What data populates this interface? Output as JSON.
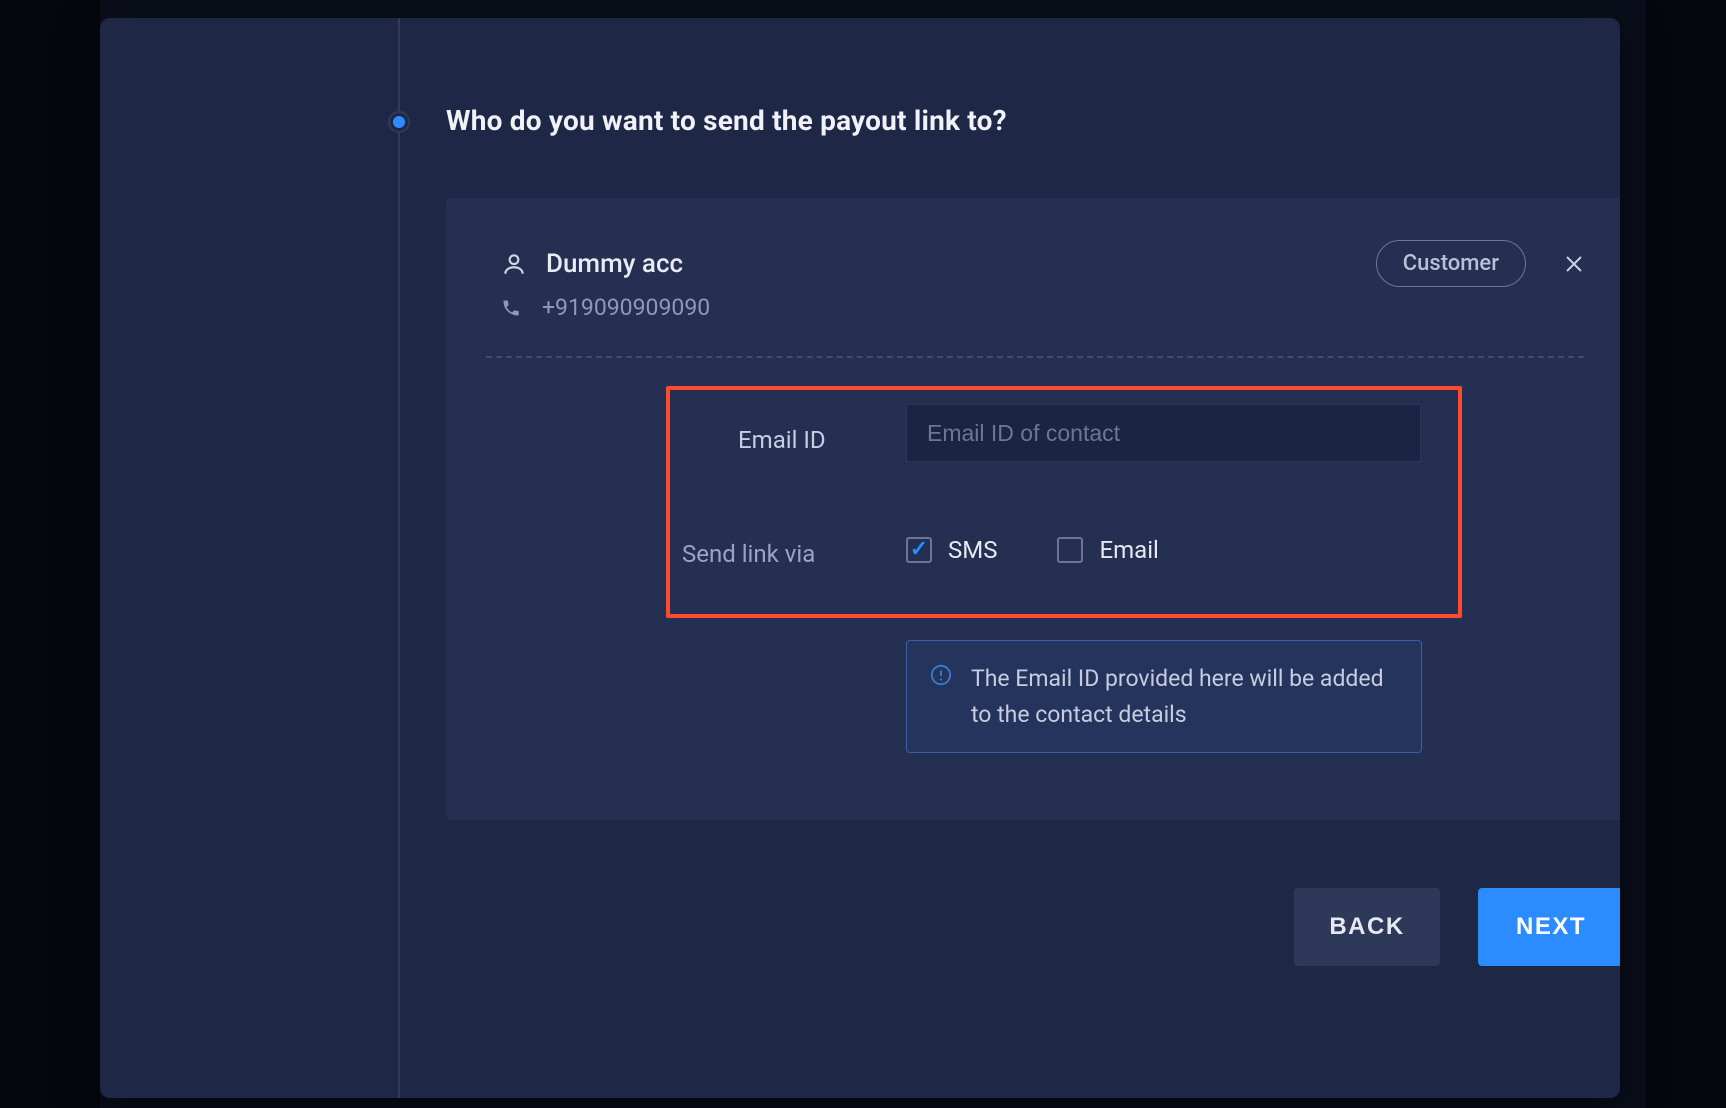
{
  "step": {
    "title": "Who do you want to send the payout link to?"
  },
  "contact": {
    "name": "Dummy acc",
    "role": "Customer",
    "phone": "+919090909090"
  },
  "form": {
    "email_label": "Email ID",
    "email_placeholder": "Email ID of contact",
    "email_value": "",
    "send_via_label": "Send link via",
    "options": {
      "sms": {
        "label": "SMS",
        "checked": true
      },
      "email": {
        "label": "Email",
        "checked": false
      }
    },
    "info_text": "The Email ID provided here will be added to the contact details"
  },
  "footer": {
    "back_label": "BACK",
    "next_label": "NEXT"
  }
}
